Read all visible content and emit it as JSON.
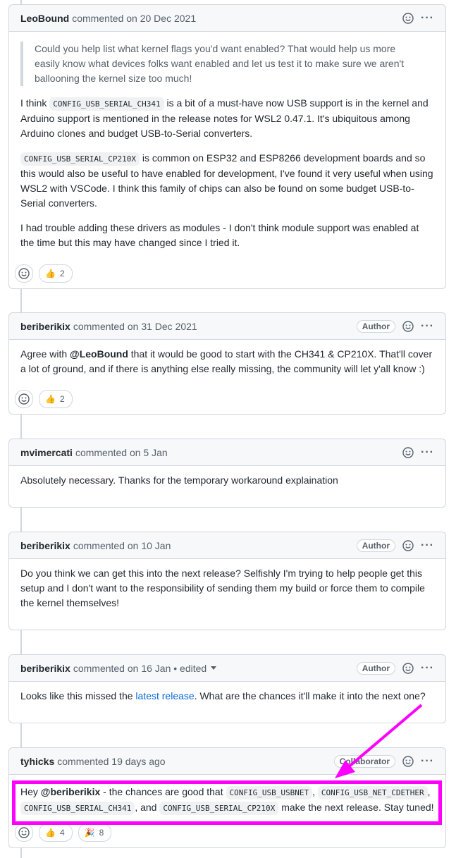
{
  "comments": [
    {
      "author": "LeoBound",
      "meta": "commented on 20 Dec 2021",
      "quote": "Could you help list what kernel flags you'd want enabled? That would help us more easily know what devices folks want enabled and let us test it to make sure we aren't ballooning the kernel size too much!",
      "p1_a": "I think ",
      "p1_code": "CONFIG_USB_SERIAL_CH341",
      "p1_b": " is a bit of a must-have now USB support is in the kernel and Arduino support is mentioned in the release notes for WSL2 0.47.1. It's ubiquitous among Arduino clones and budget USB-to-Serial converters.",
      "p2_code": "CONFIG_USB_SERIAL_CP210X",
      "p2_b": " is common on ESP32 and ESP8266 development boards and so this would also be useful to have enabled for development, I've found it very useful when using WSL2 with VSCode. I think this family of chips can also be found on some budget USB-to-Serial converters.",
      "p3": "I had trouble adding these drivers as modules - I don't think module support was enabled at the time but this may have changed since I tried it.",
      "thumbs_count": "2"
    },
    {
      "author": "beriberikix",
      "meta": "commented on 31 Dec 2021",
      "badge": "Author",
      "p_a": "Agree with ",
      "mention": "@LeoBound",
      "p_b": " that it would be good to start with the CH341 & CP210X. That'll cover a lot of ground, and if there is anything else really missing, the community will let y'all know :)",
      "thumbs_count": "2"
    },
    {
      "author": "mvimercati",
      "meta": "commented on 5 Jan",
      "p": "Absolutely necessary. Thanks for the temporary workaround explaination"
    },
    {
      "author": "beriberikix",
      "meta": "commented on 10 Jan",
      "badge": "Author",
      "p": "Do you think we can get this into the next release? Selfishly I'm trying to help people get this setup and I don't want to the responsibility of sending them my build or force them to compile the kernel themselves!"
    },
    {
      "author": "beriberikix",
      "meta": "commented on 16 Jan • edited",
      "badge": "Author",
      "p_a": "Looks like this missed the ",
      "link": "latest release",
      "p_b": ". What are the chances it'll make it into the next one?"
    },
    {
      "author": "tyhicks",
      "meta": "commented 19 days ago",
      "badge": "Collaborator",
      "p_a": "Hey ",
      "mention": "@beriberikix",
      "p_b": " - the chances are good that ",
      "code1": "CONFIG_USB_USBNET",
      "sep1": ", ",
      "code2": "CONFIG_USB_NET_CDETHER",
      "sep2": ", ",
      "code3": "CONFIG_USB_SERIAL_CH341",
      "p_c": ", and ",
      "code4": "CONFIG_USB_SERIAL_CP210X",
      "p_d": " make the next release. Stay tuned!",
      "thumbs_count": "4",
      "hooray_count": "8"
    }
  ],
  "icons": {
    "reaction_add": "smiley-icon",
    "menu": "kebab-icon",
    "thumbs": "thumbs-up-icon",
    "hooray": "party-popper-icon"
  },
  "colors": {
    "annotation": "#ff00ff",
    "link": "#0969da",
    "border": "#d0d7de"
  }
}
